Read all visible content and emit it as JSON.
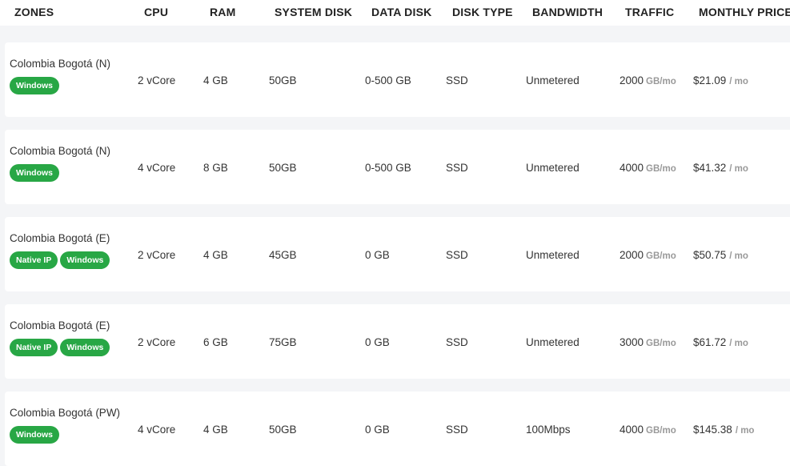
{
  "header": {
    "zones": "ZONES",
    "cpu": "CPU",
    "ram": "RAM",
    "system_disk": "SYSTEM DISK",
    "data_disk": "DATA DISK",
    "disk_type": "DISK TYPE",
    "bandwidth": "BANDWIDTH",
    "traffic": "TRAFFIC",
    "monthly_price": "MONTHLY PRICE"
  },
  "colors": {
    "badge": "#28a745",
    "row_background": "#ffffff",
    "page_background": "#f4f5f7"
  },
  "rows": [
    {
      "zone": "Colombia Bogotá (N)",
      "badges": [
        "Windows"
      ],
      "cpu": "2 vCore",
      "ram": "4 GB",
      "system_disk": "50GB",
      "data_disk": "0-500 GB",
      "disk_type": "SSD",
      "bandwidth": "Unmetered",
      "traffic": "2000",
      "traffic_unit": "GB/mo",
      "price": "$21.09",
      "price_unit": "/ mo"
    },
    {
      "zone": "Colombia Bogotá (N)",
      "badges": [
        "Windows"
      ],
      "cpu": "4 vCore",
      "ram": "8 GB",
      "system_disk": "50GB",
      "data_disk": "0-500 GB",
      "disk_type": "SSD",
      "bandwidth": "Unmetered",
      "traffic": "4000",
      "traffic_unit": "GB/mo",
      "price": "$41.32",
      "price_unit": "/ mo"
    },
    {
      "zone": "Colombia Bogotá (E)",
      "badges": [
        "Native IP",
        "Windows"
      ],
      "cpu": "2 vCore",
      "ram": "4 GB",
      "system_disk": "45GB",
      "data_disk": "0 GB",
      "disk_type": "SSD",
      "bandwidth": "Unmetered",
      "traffic": "2000",
      "traffic_unit": "GB/mo",
      "price": "$50.75",
      "price_unit": "/ mo"
    },
    {
      "zone": "Colombia Bogotá (E)",
      "badges": [
        "Native IP",
        "Windows"
      ],
      "cpu": "2 vCore",
      "ram": "6 GB",
      "system_disk": "75GB",
      "data_disk": "0 GB",
      "disk_type": "SSD",
      "bandwidth": "Unmetered",
      "traffic": "3000",
      "traffic_unit": "GB/mo",
      "price": "$61.72",
      "price_unit": "/ mo"
    },
    {
      "zone": "Colombia Bogotá (PW)",
      "badges": [
        "Windows"
      ],
      "cpu": "4 vCore",
      "ram": "4 GB",
      "system_disk": "50GB",
      "data_disk": "0 GB",
      "disk_type": "SSD",
      "bandwidth": "100Mbps",
      "traffic": "4000",
      "traffic_unit": "GB/mo",
      "price": "$145.38",
      "price_unit": "/ mo"
    }
  ]
}
